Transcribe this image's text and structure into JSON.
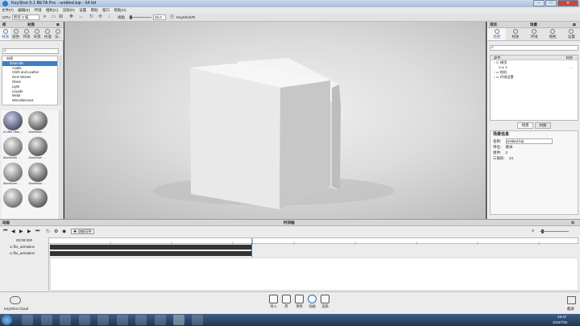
{
  "window": {
    "title": "KeyShot 5.1 BETA Pro - untitled.bip - 64 bit"
  },
  "menu": [
    "文件(F)",
    "编辑(E)",
    "环境",
    "相机(C)",
    "渲染(R)",
    "设置",
    "帮助",
    "窗口",
    "帮助(H)"
  ],
  "toolbar": {
    "cpu_label": "CPU",
    "cpu_value": "所有 8 核",
    "fov_label": "视角",
    "fov_value": "35.0",
    "keyshotvr": "KeyShotVR"
  },
  "library": {
    "panel_left": "库",
    "panel_title": "材质",
    "tabs": [
      "材质",
      "颜色",
      "环境",
      "背景",
      "纹理",
      "渲…"
    ],
    "tree": [
      "材质",
      "Materials",
      "Axalta",
      "Cloth and Leather",
      "Gem Stones",
      "Glass",
      "Light",
      "Liquids",
      "Metal",
      "Miscellaneous"
    ],
    "thumbs": [
      "A Little Lilac…",
      "Aluminum …",
      "Aluminum …",
      "Aluminum …",
      "Aluminum …",
      "Aluminum …",
      "",
      ""
    ]
  },
  "project": {
    "panel_left": "项目",
    "panel_title": "场景",
    "tabs": [
      "场景",
      "材质",
      "环境",
      "相机",
      "设置"
    ],
    "col_part": "部件",
    "col_material": "材质",
    "tree": [
      "模型",
      "1",
      "相机",
      "环境设置"
    ],
    "subtabs": [
      "场景",
      "材质"
    ],
    "info_title": "场景信息",
    "info": [
      {
        "k": "名称:",
        "v": "untitled.bip"
      },
      {
        "k": "单位:",
        "v": "厘米"
      },
      {
        "k": "组件:",
        "v": "2"
      },
      {
        "k": "三角形:",
        "v": "24"
      }
    ]
  },
  "animation": {
    "panel_left": "动画",
    "panel_title": "时间轴",
    "wizard": "动画向导",
    "time": "00:00:000",
    "tracks": [
      "fbx_animation",
      "fbx_animation"
    ]
  },
  "appbar": {
    "cloud": "KeyShot Cloud",
    "buttons": [
      "导入",
      "库",
      "项目",
      "动画",
      "渲染"
    ],
    "screenshot": "截屏"
  },
  "taskbar": {
    "time": "15:47",
    "date": "2015/7/31"
  }
}
